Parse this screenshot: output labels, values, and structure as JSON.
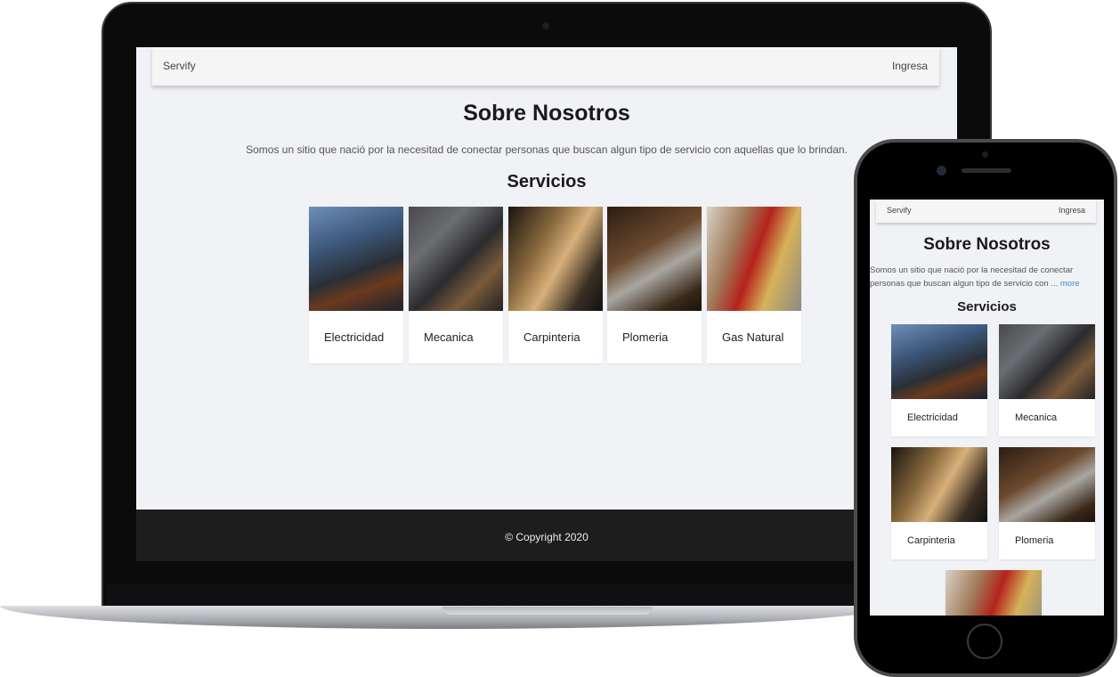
{
  "site": {
    "brand": "Servify",
    "login_label": "Ingresa"
  },
  "about": {
    "title": "Sobre Nosotros",
    "description": "Somos un sitio que nació por la necesitad de conectar personas que buscan algun tipo de servicio con aquellas que lo brindan.",
    "mobile_description": "Somos un sitio que nació por la necesitad de conectar personas que buscan algun tipo de servicio con ...",
    "more_label": "more"
  },
  "services": {
    "title": "Servicios",
    "items": [
      {
        "label": "Electricidad"
      },
      {
        "label": "Mecanica"
      },
      {
        "label": "Carpinteria"
      },
      {
        "label": "Plomeria"
      },
      {
        "label": "Gas Natural"
      }
    ]
  },
  "footer": {
    "copyright": "© Copyright 2020"
  }
}
